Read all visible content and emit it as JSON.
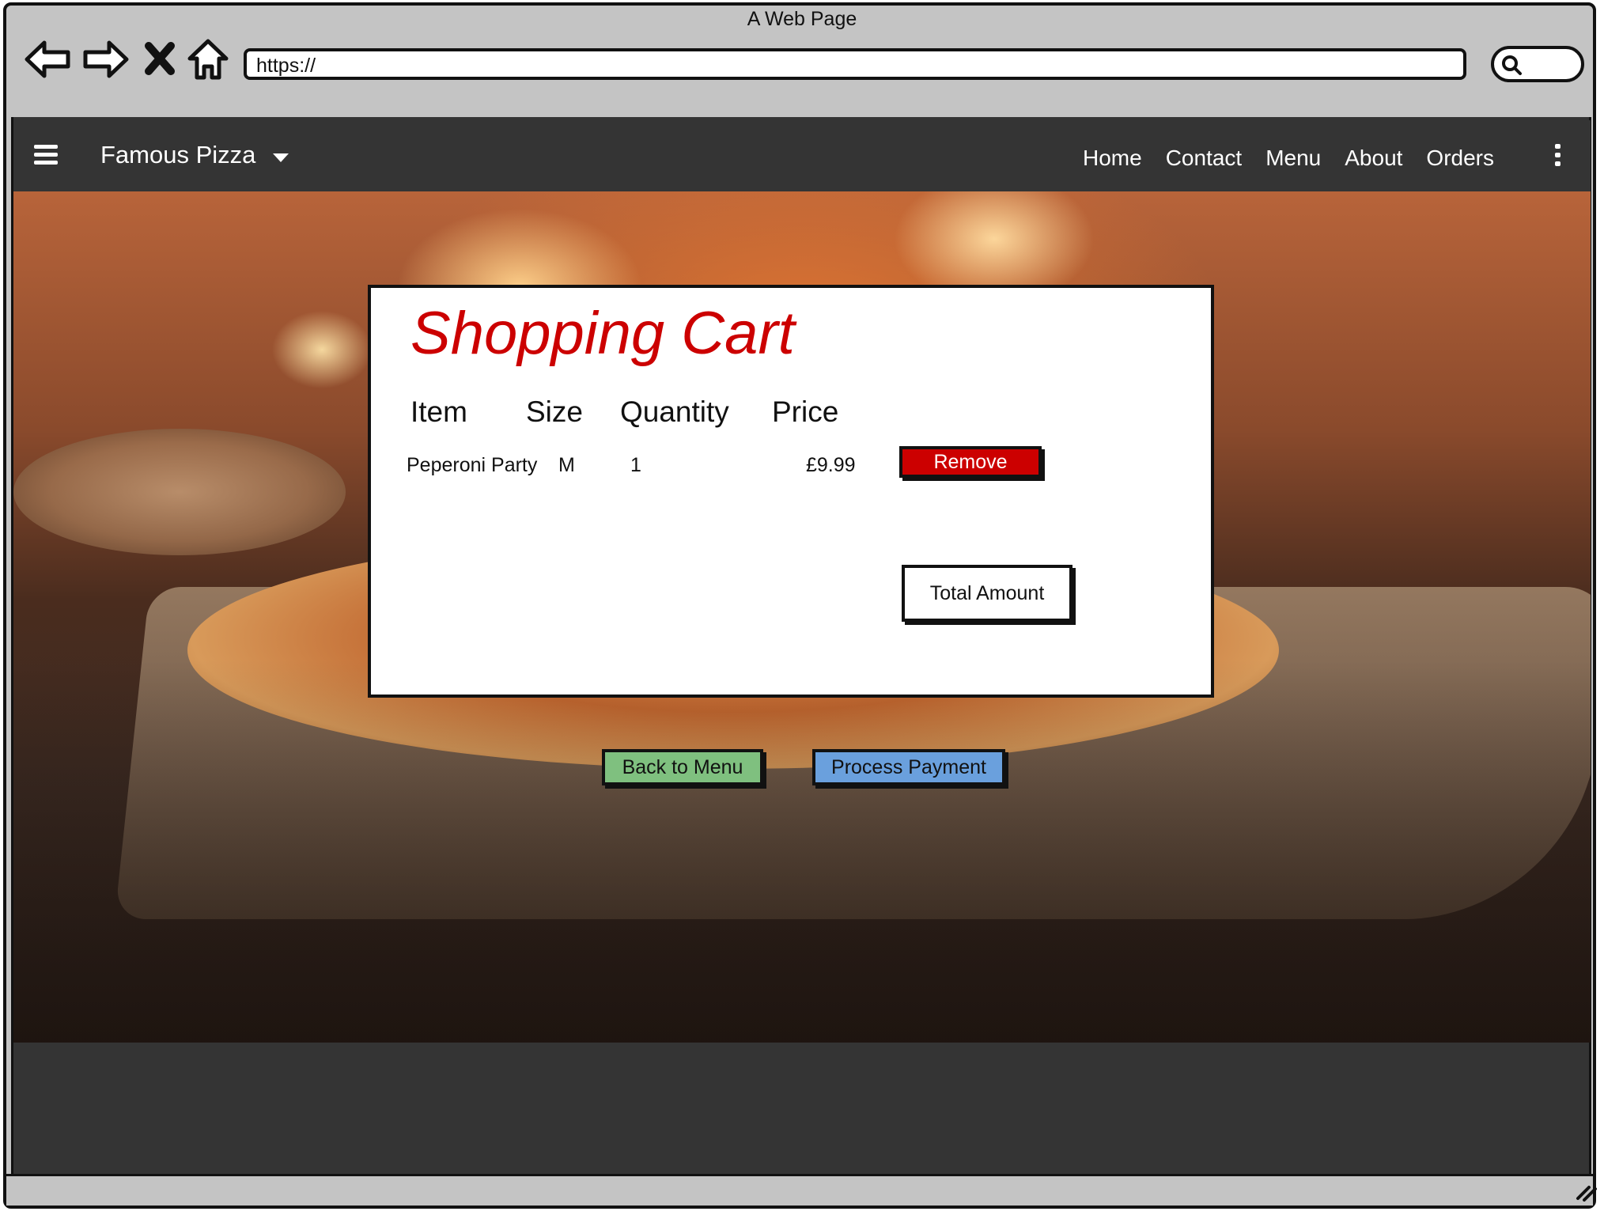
{
  "window": {
    "title": "A Web Page",
    "url": "https://"
  },
  "browser_icons": [
    "back-arrow-icon",
    "forward-arrow-icon",
    "close-x-icon",
    "home-icon",
    "search-icon",
    "resize-grip-icon"
  ],
  "navbar": {
    "brand": "Famous Pizza",
    "links": [
      "Home",
      "Contact",
      "Menu",
      "About",
      "Orders"
    ]
  },
  "cart": {
    "title": "Shopping Cart",
    "columns": [
      "Item",
      "Size",
      "Quantity",
      "Price"
    ],
    "rows": [
      {
        "item": "Peperoni Party",
        "size": "M",
        "quantity": "1",
        "price": "£9.99",
        "action": "Remove"
      }
    ],
    "total_label": "Total Amount"
  },
  "actions": {
    "back_label": "Back to Menu",
    "payment_label": "Process Payment"
  },
  "colors": {
    "title_red": "#cc0000",
    "remove_red": "#cc0000",
    "back_green": "#7fc07f",
    "payment_blue": "#6aa0dd",
    "navbar_dark": "#343434",
    "frame_gray": "#c4c4c4"
  }
}
